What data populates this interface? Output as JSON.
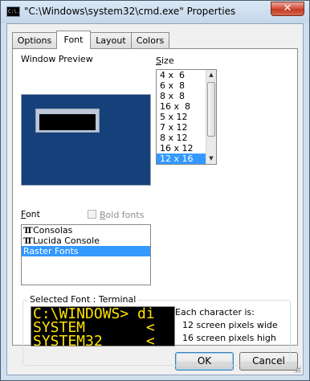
{
  "window": {
    "title": "\"C:\\Windows\\system32\\cmd.exe\" Properties",
    "app_icon_text": "C:\\.",
    "close_glyph": "✕"
  },
  "tabs": [
    {
      "label": "Options"
    },
    {
      "label": "Font"
    },
    {
      "label": "Layout"
    },
    {
      "label": "Colors"
    }
  ],
  "active_tab": "Font",
  "preview": {
    "label": "Window Preview"
  },
  "size": {
    "label": "Size",
    "items": [
      "4 x  6",
      "6 x  8",
      "8 x  8",
      "16 x  8",
      "5 x 12",
      "7 x 12",
      "8 x 12",
      "16 x 12",
      "12 x 16"
    ],
    "selected": "12 x 16"
  },
  "font": {
    "label": "Font",
    "bold_label": "Bold fonts",
    "bold_checked": false,
    "items": [
      {
        "name": "Consolas",
        "icon": "truetype-icon"
      },
      {
        "name": "Lucida Console",
        "icon": "truetype-icon"
      },
      {
        "name": "Raster Fonts",
        "icon": ""
      }
    ],
    "selected": "Raster Fonts"
  },
  "selected_font": {
    "label": "Selected Font : Terminal",
    "preview_lines": [
      "C:\\WINDOWS> di",
      "SYSTEM       <",
      "SYSTEM32     <"
    ],
    "each_char": "Each character is:",
    "wide": "12 screen pixels wide",
    "high": "16 screen pixels high"
  },
  "buttons": {
    "ok": "OK",
    "cancel": "Cancel"
  },
  "colors": {
    "preview_bg": "#16407a",
    "selection": "#3399ff",
    "terminal_text": "#ffe400"
  }
}
